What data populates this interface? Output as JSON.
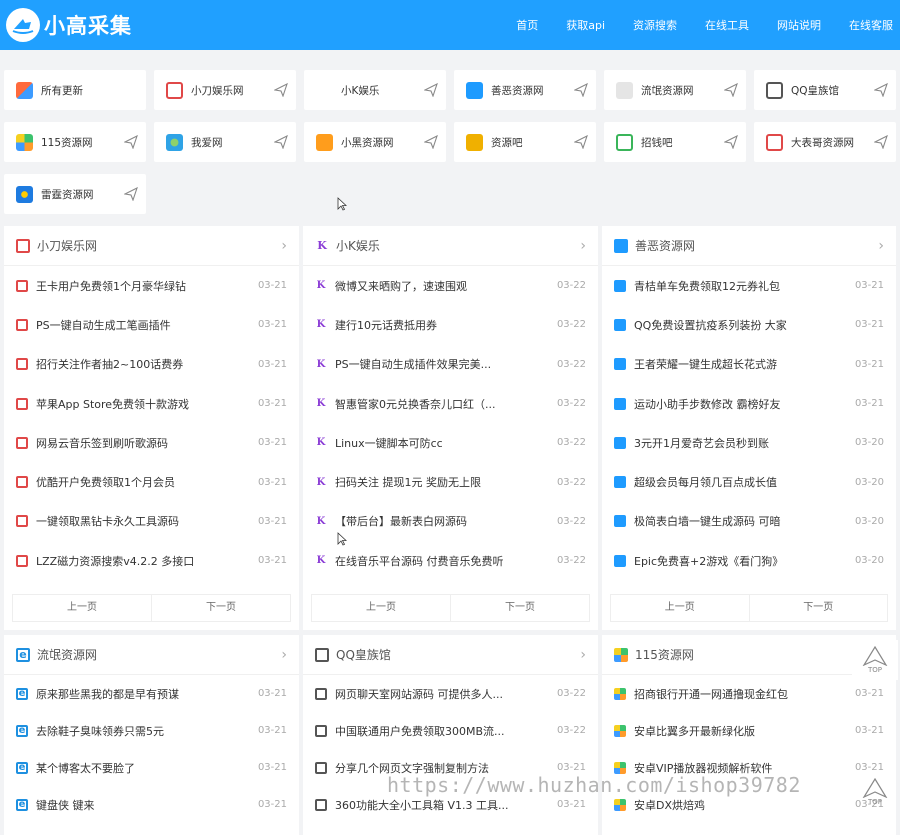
{
  "header": {
    "logo_text": "小高采集",
    "nav": [
      "首页",
      "获取api",
      "资源搜索",
      "在线工具",
      "网站说明",
      "在线客服"
    ]
  },
  "categories": [
    {
      "label": "所有更新",
      "icon": "multicolor-dots-icon"
    },
    {
      "label": "小刀娱乐网",
      "icon": "qr-icon"
    },
    {
      "label": "小K娱乐",
      "icon": "k-logo-icon"
    },
    {
      "label": "善恶资源网",
      "icon": "doc-icon"
    },
    {
      "label": "流氓资源网",
      "icon": "blank-icon"
    },
    {
      "label": "QQ皇族馆",
      "icon": "crown-icon"
    },
    {
      "label": "115资源网",
      "icon": "grid-icon"
    },
    {
      "label": "我爱网",
      "icon": "globe-icon"
    },
    {
      "label": "小黑资源网",
      "icon": "badge-icon"
    },
    {
      "label": "资源吧",
      "icon": "bag-icon"
    },
    {
      "label": "招钱吧",
      "icon": "phone-icon"
    },
    {
      "label": "大表哥资源网",
      "icon": "red-circle-icon"
    },
    {
      "label": "雷霆资源网",
      "icon": "storm-icon"
    }
  ],
  "panels": [
    {
      "title": "小刀娱乐网",
      "icon": "qr-icon",
      "rows": [
        {
          "text": "王卡用户免费领1个月豪华绿钻",
          "date": "03-21"
        },
        {
          "text": "PS一键自动生成工笔画插件",
          "date": "03-21"
        },
        {
          "text": "招行关注作者抽2~100话费券",
          "date": "03-21"
        },
        {
          "text": "苹果App Store免费领十款游戏",
          "date": "03-21"
        },
        {
          "text": "网易云音乐签到刷听歌源码",
          "date": "03-21"
        },
        {
          "text": "优酷开户免费领取1个月会员",
          "date": "03-21"
        },
        {
          "text": "一键领取黑钻卡永久工具源码",
          "date": "03-21"
        },
        {
          "text": "LZZ磁力资源搜索v4.2.2 多接口",
          "date": "03-21"
        }
      ],
      "prev": "上一页",
      "next": "下一页"
    },
    {
      "title": "小K娱乐",
      "icon": "k-logo-icon",
      "rows": [
        {
          "text": "微博又来晒购了，速速围观",
          "date": "03-22"
        },
        {
          "text": "建行10元话费抵用券",
          "date": "03-22"
        },
        {
          "text": "PS一键自动生成插件效果完美...",
          "date": "03-22"
        },
        {
          "text": "智惠管家0元兑换香奈儿口红（...",
          "date": "03-22"
        },
        {
          "text": "Linux一键脚本可防cc",
          "date": "03-22"
        },
        {
          "text": "扫码关注 提现1元 奖励无上限",
          "date": "03-22"
        },
        {
          "text": "【带后台】最新表白网源码",
          "date": "03-22"
        },
        {
          "text": "在线音乐平台源码 付费音乐免费听",
          "date": "03-22"
        }
      ],
      "prev": "上一页",
      "next": "下一页"
    },
    {
      "title": "善恶资源网",
      "icon": "doc-icon",
      "rows": [
        {
          "text": "青桔单车免费领取12元券礼包",
          "date": "03-21"
        },
        {
          "text": "QQ免费设置抗疫系列装扮 大家",
          "date": "03-21"
        },
        {
          "text": "王者荣耀一键生成超长花式游",
          "date": "03-21"
        },
        {
          "text": "运动小助手步数修改 霸榜好友",
          "date": "03-21"
        },
        {
          "text": "3元开1月爱奇艺会员秒到账",
          "date": "03-20"
        },
        {
          "text": "超级会员每月领几百点成长值",
          "date": "03-20"
        },
        {
          "text": "极简表白墙一键生成源码 可暗",
          "date": "03-20"
        },
        {
          "text": "Epic免费喜+2游戏《看门狗》",
          "date": "03-20"
        }
      ],
      "prev": "上一页",
      "next": "下一页"
    },
    {
      "title": "流氓资源网",
      "icon": "ie-icon",
      "rows": [
        {
          "text": "原来那些黑我的都是早有预谋",
          "date": "03-21"
        },
        {
          "text": "去除鞋子臭味领券只需5元",
          "date": "03-21"
        },
        {
          "text": "某个博客太不要脸了",
          "date": "03-21"
        },
        {
          "text": "键盘侠 键来",
          "date": "03-21"
        }
      ]
    },
    {
      "title": "QQ皇族馆",
      "icon": "crown-icon",
      "rows": [
        {
          "text": "网页聊天室网站源码 可提供多人...",
          "date": "03-22"
        },
        {
          "text": "中国联通用户免费领取300MB流...",
          "date": "03-22"
        },
        {
          "text": "分享几个网页文字强制复制方法",
          "date": "03-21"
        },
        {
          "text": "360功能大全小工具箱 V1.3 工具...",
          "date": "03-21"
        }
      ]
    },
    {
      "title": "115资源网",
      "icon": "grid-icon",
      "rows": [
        {
          "text": "招商银行开通一网通撸现金红包",
          "date": "03-21"
        },
        {
          "text": "安卓比翼多开最新绿化版",
          "date": "03-21"
        },
        {
          "text": "安卓VIP播放器视频解析软件",
          "date": "03-21"
        },
        {
          "text": "安卓DX烘焙鸡",
          "date": "03-21"
        }
      ]
    }
  ],
  "top_button": "TOP",
  "watermark": "https://www.huzhan.com/ishop39782"
}
